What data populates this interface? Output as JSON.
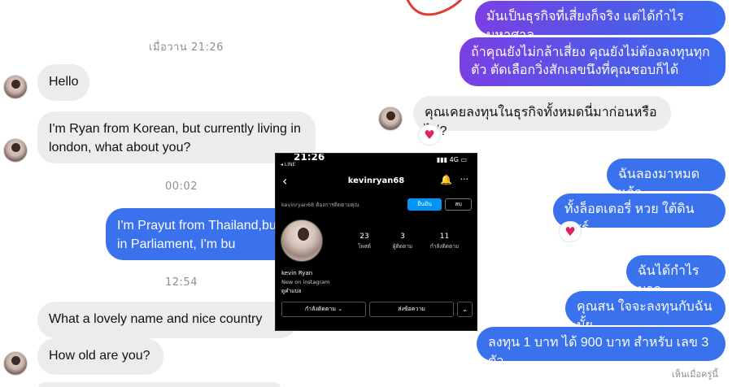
{
  "left": {
    "time1": "เมื่อวาน 21:26",
    "msg_hello": "Hello",
    "msg_ryan": "I'm Ryan from Korean, but currently living in london, what about you?",
    "time2": "00:02",
    "msg_prayut": "I'm Prayut from Thailand,but currently living in Parliament, I'm bu",
    "time3": "12:54",
    "msg_lovely": "What a lovely name and nice country",
    "msg_age": "How old are you?"
  },
  "right": {
    "msg_risky": "มันเป็นธุรกิจที่เสี่ยงก็จริง แต่ได้กำไรมหาศาล",
    "msg_dare": "ถ้าคุณยังไม่กล้าเสี่ยง คุณยังไม่ต้องลงทุนทุกตัว ตัดเลือกวิ่งสักเลขนึงที่คุณชอบก็ได้",
    "msg_invested": "คุณเคยลงทุนในธุรกิจทั้งหมดนี่มาก่อนหรือไม่?",
    "msg_tried": "ฉันลองมาหมดแล้ว",
    "msg_lottery": "ทั้งล็อตเตอรี่ หวย ใต้ดิน แชร์",
    "msg_profit": "ฉันได้กำไรมาก",
    "msg_interest": "คุณสน ใจจะลงทุนกับฉันมั้ย",
    "msg_offer": "ลงทุน 1 บาท ได้ 900 บาท สำหรับ เลข 3 ตัว",
    "seen": "เห็นเมื่อครู่นี้",
    "heart": "♥"
  },
  "instagram": {
    "status_time": "21:26",
    "status_app": "◂ LINE",
    "status_right": "▮▮▮ 4G ▭",
    "back": "‹",
    "username": "kevinryan68",
    "bell": "🔔",
    "more": "···",
    "request_text": "kevinryan68 ต้องการติดตามคุณ",
    "accept": "ยืนยัน",
    "delete": "ลบ",
    "posts_count": "23",
    "posts_label": "โพสต์",
    "followers_count": "3",
    "followers_label": "ผู้ติดตาม",
    "following_count": "11",
    "following_label": "กำลังติดตาม",
    "display_name": "kevin Ryan",
    "bio": "New on instagram",
    "translate": "ดูคำแปล",
    "follow_btn": "กำลังติดตาม ⌄",
    "message_btn": "ส่งข้อความ",
    "dropdown_btn": "⌄"
  },
  "colors": {
    "incoming": "#ececec",
    "outgoing_blue": "#3a71ec",
    "outgoing_purple": "#7b3fe4",
    "heart": "#e0245e"
  }
}
